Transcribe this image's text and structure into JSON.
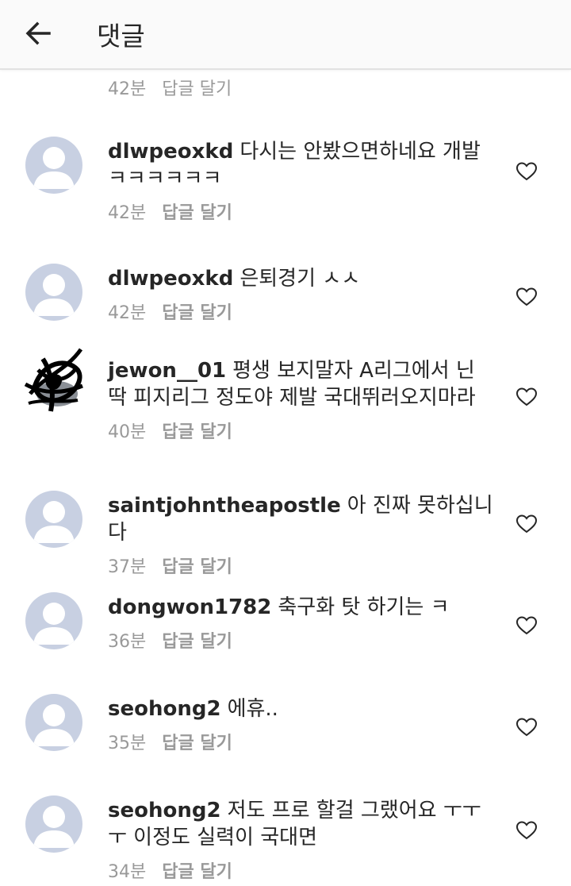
{
  "header": {
    "title": "댓글"
  },
  "top_meta": {
    "time": "42분",
    "reply_label": "답글 달기"
  },
  "comments": [
    {
      "username": "dlwpeoxkd",
      "text": "다시는 안봤으면하네요 개발 ㅋㅋㅋㅋㅋㅋ",
      "time": "42분",
      "reply_label": "답글 달기"
    },
    {
      "username": "dlwpeoxkd",
      "text": "은퇴경기 ㅅㅅ",
      "time": "42분",
      "reply_label": "답글 달기"
    },
    {
      "username": "jewon__01",
      "text": "평생 보지말자 A리그에서 닌 딱 피지리그 정도야 제발 국대뛰러오지마라",
      "time": "40분",
      "reply_label": "답글 달기"
    },
    {
      "username": "saintjohntheapostle",
      "text": "아 진짜 못하십니다",
      "time": "37분",
      "reply_label": "답글 달기"
    },
    {
      "username": "dongwon1782",
      "text": "축구화 탓 하기는 ㅋ",
      "time": "36분",
      "reply_label": "답글 달기"
    },
    {
      "username": "seohong2",
      "text": "에휴..",
      "time": "35분",
      "reply_label": "답글 달기"
    },
    {
      "username": "seohong2",
      "text": "저도 프로 할걸 그랬어요 ㅜㅜㅜ 이정도 실력이 국대면",
      "time": "34분",
      "reply_label": "답글 달기"
    }
  ],
  "colors": {
    "avatar_bg": "#c8d0e2",
    "avatar_fg": "#ffffff",
    "meta_text": "#999999",
    "text": "#262626"
  },
  "icons": {
    "back": "arrow-left-icon",
    "like": "heart-outline-icon",
    "avatar": "default-user-icon"
  }
}
